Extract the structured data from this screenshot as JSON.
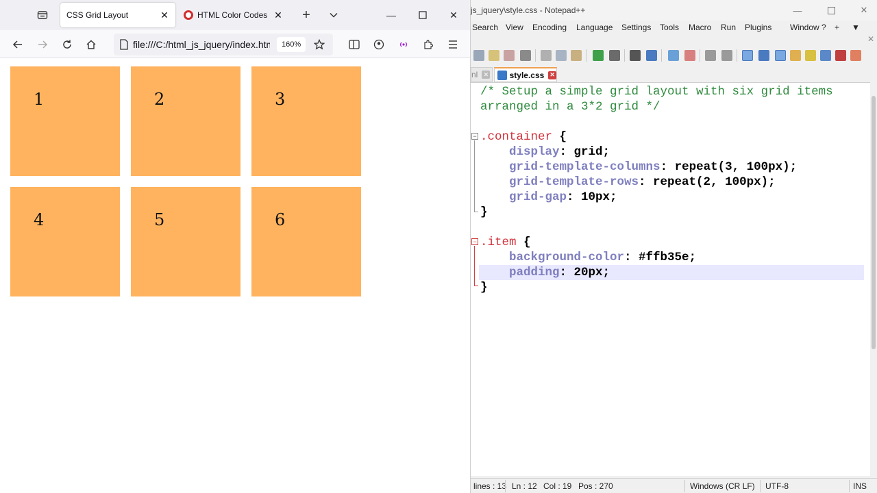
{
  "firefox": {
    "tabs": [
      {
        "label": "CSS Grid Layout",
        "active": true
      },
      {
        "label": "HTML Color Codes",
        "active": false
      }
    ],
    "url": "file:///C:/html_js_jquery/index.html",
    "zoom": "160%",
    "grid_items": [
      "1",
      "2",
      "3",
      "4",
      "5",
      "6"
    ],
    "item_color": "#ffb35e"
  },
  "notepad": {
    "title": "js_jquery\\style.css - Notepad++",
    "menu": [
      "Search",
      "View",
      "Encoding",
      "Language",
      "Settings",
      "Tools",
      "Macro",
      "Run",
      "Plugins",
      "Window",
      "?",
      "+",
      "▼"
    ],
    "tabs": [
      {
        "label": "nl",
        "active": false
      },
      {
        "label": "style.css",
        "active": true
      }
    ],
    "code": {
      "line1": "/* Setup a simple grid layout with six grid items",
      "line2": "arranged in a 3*2 grid */",
      "container_sel": ".container",
      "brace_open": " {",
      "display_prop": "display",
      "display_val": ": grid;",
      "gtc_prop": "grid-template-columns",
      "gtc_val": ": repeat(3, 100px);",
      "gtr_prop": "grid-template-rows",
      "gtr_val": ": repeat(2, 100px);",
      "gap_prop": "grid-gap",
      "gap_val": ": 10px;",
      "brace_close": "}",
      "item_sel": ".item",
      "bg_prop": "background-color",
      "bg_val": ": #ffb35e;",
      "pad_prop": "padding",
      "pad_val": ": 20px;"
    },
    "status": {
      "lines": "lines : 13",
      "ln": "Ln : 12",
      "col": "Col : 19",
      "pos": "Pos : 270",
      "eol": "Windows (CR LF)",
      "encoding": "UTF-8",
      "mode": "INS"
    }
  }
}
